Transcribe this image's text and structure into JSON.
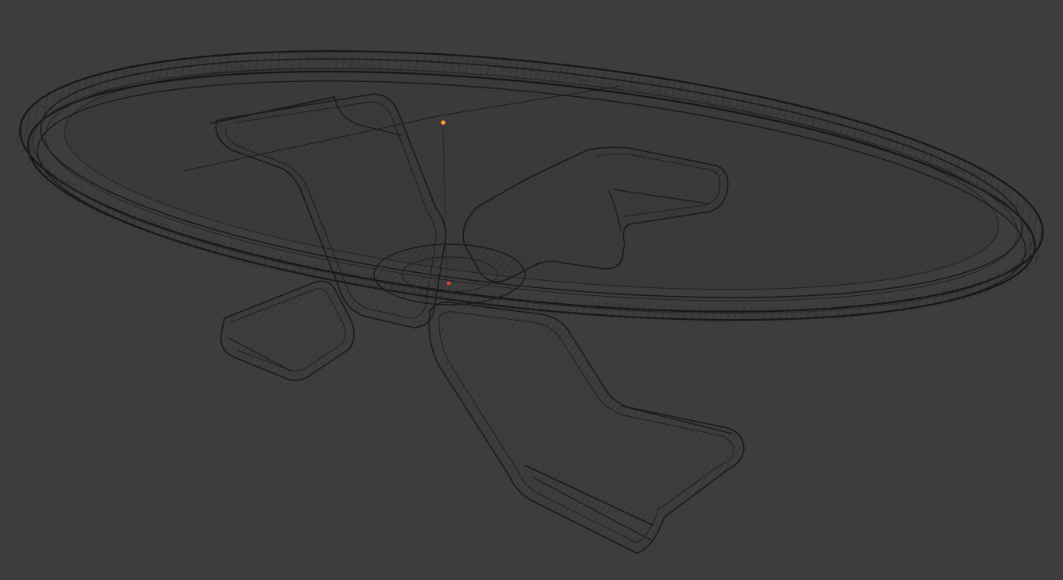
{
  "viewport": {
    "mode": "wireframe",
    "object": "table",
    "background_color": "#3d3d3d",
    "wire_color": "#1a1a1a",
    "face_color": "#3a3a3a",
    "light_color": "#ff9a2e",
    "origin_color": "#d4422a"
  }
}
